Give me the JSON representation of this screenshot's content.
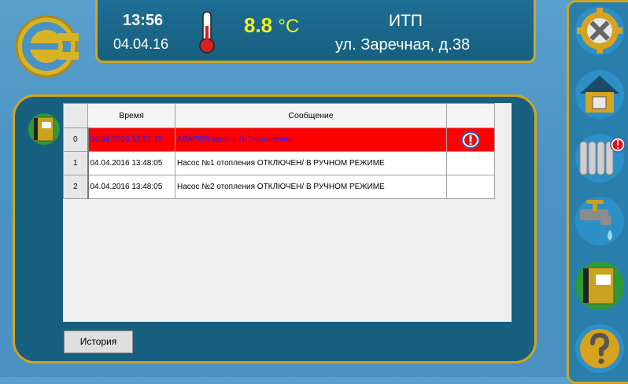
{
  "header": {
    "time": "13:56",
    "date": "04.04.16",
    "temperature": "8.8",
    "temperature_unit": "°C",
    "title": "ИТП",
    "address": "ул. Заречная, д.38"
  },
  "alarm_table": {
    "columns": [
      "Время",
      "Сообщение"
    ],
    "rows": [
      {
        "index": "0",
        "time": "04.04.2016 13:51:15",
        "message": "АВАРИЯ насоса №1 отопления!",
        "status": "alarm"
      },
      {
        "index": "1",
        "time": "04.04.2016 13:48:05",
        "message": "Насос  №1 отопления ОТКЛЮЧЕН/ В РУЧНОМ РЕЖИМЕ",
        "status": "normal"
      },
      {
        "index": "2",
        "time": "04.04.2016 13:48:05",
        "message": "Насос  №2 отопления ОТКЛЮЧЕН/ В РУЧНОМ РЕЖИМЕ",
        "status": "normal"
      }
    ]
  },
  "buttons": {
    "history": "История"
  },
  "nav": [
    "settings-icon",
    "home-icon",
    "radiator-alarm-icon",
    "water-tap-icon",
    "alarm-log-icon",
    "help-icon"
  ],
  "colors": {
    "accent_gold": "#d1a51f",
    "panel_blue": "#18607f",
    "alarm_red": "#ff0000",
    "temperature_yellow": "#f0f01a"
  }
}
